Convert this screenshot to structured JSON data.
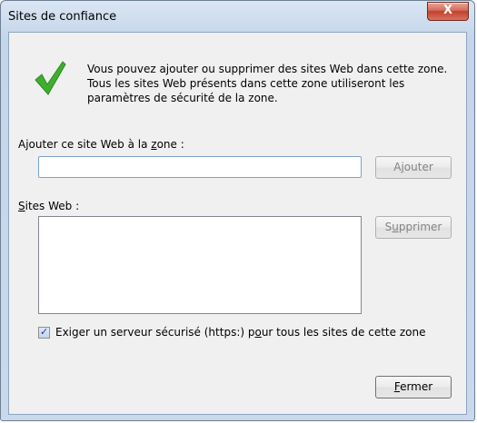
{
  "window": {
    "title": "Sites de confiance",
    "close_glyph": "X"
  },
  "info": {
    "icon": "green-checkmark-icon",
    "text": "Vous pouvez ajouter ou supprimer des sites Web dans cette zone. Tous les sites Web présents dans cette zone utiliseront les paramètres de sécurité de la zone."
  },
  "add_site": {
    "label_prefix": "Ajouter ce site Web à la ",
    "label_accel": "z",
    "label_suffix": "one :",
    "input_value": "",
    "button_prefix": "A",
    "button_accel": "j",
    "button_suffix": "outer"
  },
  "sites": {
    "label_accel": "S",
    "label_suffix": "ites Web :",
    "items": [],
    "remove_prefix": "S",
    "remove_accel": "u",
    "remove_suffix": "pprimer"
  },
  "https": {
    "checked": true,
    "label_prefix": "Exiger un serveur sécurisé (https:) p",
    "label_accel": "o",
    "label_suffix": "ur tous les sites de cette zone"
  },
  "footer": {
    "close_accel": "F",
    "close_suffix": "ermer"
  },
  "colors": {
    "title_bar": "#c9d9ec",
    "client_bg": "#f0f0f0",
    "check_green": "#3fae2f",
    "close_red": "#c0402b"
  }
}
